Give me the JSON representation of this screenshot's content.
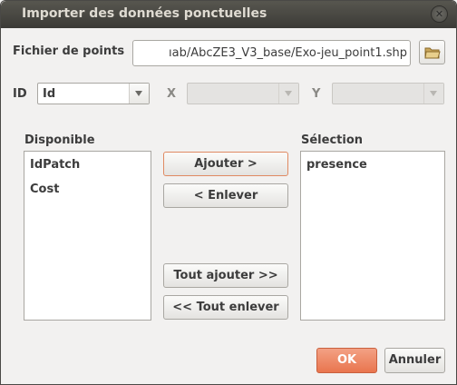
{
  "window": {
    "title": "Importer des données ponctuelles",
    "close_icon": "close-icon"
  },
  "file": {
    "label": "Fichier de points",
    "path_value": "ıab/AbcZE3_V3_base/Exo-jeu_point1.shp",
    "browse_icon": "folder-open-icon"
  },
  "fields": {
    "id_label": "ID",
    "id_value": "Id",
    "x_label": "X",
    "x_value": "",
    "y_label": "Y",
    "y_value": ""
  },
  "available": {
    "label": "Disponible",
    "items": [
      "IdPatch",
      "Cost"
    ]
  },
  "selection": {
    "label": "Sélection",
    "items": [
      "presence"
    ]
  },
  "buttons": {
    "add": "Ajouter >",
    "remove": "< Enlever",
    "add_all": "Tout ajouter >>",
    "remove_all": "<< Tout enlever",
    "ok": "OK",
    "cancel": "Annuler"
  },
  "colors": {
    "accent": "#e9754e",
    "titlebar": "#3c3b37",
    "title_text": "#dfdbd2"
  }
}
